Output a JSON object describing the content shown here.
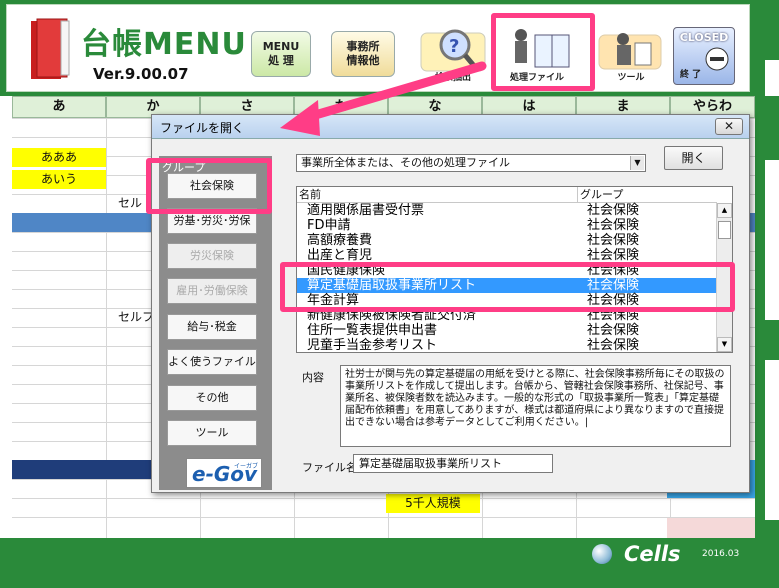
{
  "app": {
    "title": "台帳MENU",
    "version": "Ver.9.00.07",
    "buttons": {
      "menu": "MENU\n処 理",
      "office": "事務所\n情報他",
      "search": "検索抽出",
      "process_file": "処理ファイル",
      "tool": "ツール",
      "closed_top": "CLOSED",
      "closed_bottom": "終 了"
    }
  },
  "columns": [
    "あ",
    "か",
    "さ",
    "た",
    "な",
    "は",
    "ま",
    "やらわ"
  ],
  "grid": {
    "yellow_cells": [
      "あああ",
      "あいう"
    ],
    "cell_texts": [
      "セル",
      "セルフ"
    ],
    "yellow_bottom": "5千人規模"
  },
  "dialog": {
    "title": "ファイルを開く",
    "close": "✕",
    "group_legend": "グループ",
    "groups": [
      {
        "label": "社会保険",
        "disabled": false
      },
      {
        "label": "労基･労災･労保",
        "disabled": false
      },
      {
        "label": "労災保険",
        "disabled": true
      },
      {
        "label": "雇用･労働保険",
        "disabled": true
      },
      {
        "label": "給与･税金",
        "disabled": false
      },
      {
        "label": "よく使うファイル",
        "disabled": false
      },
      {
        "label": "その他",
        "disabled": false
      },
      {
        "label": "ツール",
        "disabled": false
      }
    ],
    "egov": {
      "text": "e-Gov",
      "sub": "イーガブ"
    },
    "dropdown_value": "事業所全体または、その他の処理ファイル",
    "open_button": "開く",
    "list_header": {
      "name": "名前",
      "group": "グループ"
    },
    "list_rows": [
      {
        "name": "適用関係届書受付票",
        "group": "社会保険",
        "selected": false
      },
      {
        "name": "FD申請",
        "group": "社会保険",
        "selected": false
      },
      {
        "name": "高額療養費",
        "group": "社会保険",
        "selected": false
      },
      {
        "name": "出産と育児",
        "group": "社会保険",
        "selected": false
      },
      {
        "name": "国民健康保険",
        "group": "社会保険",
        "selected": false
      },
      {
        "name": "算定基礎届取扱事業所リスト",
        "group": "社会保険",
        "selected": true
      },
      {
        "name": "年金計算",
        "group": "社会保険",
        "selected": false
      },
      {
        "name": "新健康保険被保険者証交付済",
        "group": "社会保険",
        "selected": false
      },
      {
        "name": "住所一覧表提供申出書",
        "group": "社会保険",
        "selected": false
      },
      {
        "name": "児童手当金参考リスト",
        "group": "社会保険",
        "selected": false
      }
    ],
    "content_label": "内容",
    "content_text": "社労士が関与先の算定基礎届の用紙を受けとる際に、社会保険事務所毎にその取扱の事業所リストを作成して提出します。台帳から、管轄社会保険事務所、社保記号、事業所名、被保険者数を読込みます。一般的な形式の「取扱事業所一覧表」「算定基礎届配布依頼書」を用意してありますが、様式は都道府県により異なりますので直接提出できない場合は参考データとしてご利用ください。|",
    "filename_label": "ファイル名",
    "filename_value": "算定基礎届取扱事業所リスト"
  },
  "footer": {
    "name": "Cells",
    "date": "2016.03"
  },
  "colors": {
    "brand_green": "#2a8a3a",
    "highlight_pink": "#ff3d86",
    "selection_blue": "#3399ff"
  }
}
